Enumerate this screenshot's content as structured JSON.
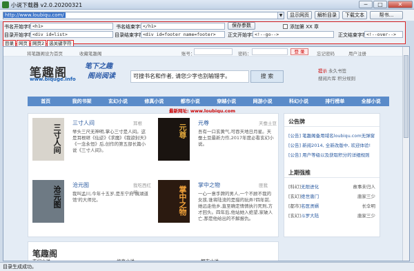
{
  "window": {
    "title": "小说下载器 v2.0.20200321",
    "min_label": "─",
    "max_label": "□",
    "close_label": "✕"
  },
  "toolbar": {
    "url": "http://www.loubiqu.com/",
    "buttons": [
      "显示网页",
      "解析目录",
      "下载文本",
      "帮书..."
    ]
  },
  "config": {
    "row1": [
      {
        "label": "书名开始字符:",
        "value": "<h1>"
      },
      {
        "label": "书名结束字符:",
        "value": "</h1>"
      }
    ],
    "save_label": "保存参数",
    "add_chapter_label": "添加第 XX 章",
    "row2": [
      {
        "label": "目录开始字符:",
        "value": "<div id=list>"
      },
      {
        "label": "目录结束字符:",
        "value": "<div id=footer name=footer>"
      },
      {
        "label": "正文开始字符:",
        "value": "<!--go-->"
      },
      {
        "label": "正文结束字符:",
        "value": "<!--over-->"
      }
    ]
  },
  "tabs": [
    "目录",
    "网页",
    "网页2",
    "选关键字符"
  ],
  "site": {
    "topbar": {
      "left_links": [
        "将笔趣阁设为首页",
        "收藏笔趣阁"
      ],
      "account_label": "账号：",
      "password_label": "密码：",
      "login_label": "登 录",
      "forgot_label": "忘记密码",
      "register_label": "用户注册"
    },
    "logo": "笔趣阁",
    "logo_sub": "www.biquge.info",
    "slogan_line1": "笔下之趣",
    "slogan_line2": "阁尚阅读",
    "search_placeholder": "可搜书名和作者, 请您少字也别输错字。",
    "search_button": "搜 索",
    "right_links": [
      "提示",
      "永久书签",
      "搜阅片库",
      "积分规则"
    ],
    "nav": [
      "首页",
      "我的书架",
      "玄幻小说",
      "修真小说",
      "都市小说",
      "穿越小说",
      "网游小说",
      "科幻小说",
      "排行榜单",
      "全部小说"
    ],
    "notice": "最新网址: www.loubiqu.com",
    "books": [
      {
        "title": "三寸人间",
        "author": "耳根",
        "desc": "举头三尺无神明,掌心三寸是人间。这是耳根继《仙逆》《求魔》《我欲封天》《一念永恒》后,创作的第五部长篇小说《三寸人间》。",
        "cover": "三寸人间",
        "cover_bg": "#d8d4cc",
        "cover_fg": "#1b1b1b"
      },
      {
        "title": "元尊",
        "author": "天蚕土豆",
        "desc": "吾有一口玄黄气,可吞天地日月星。天蚕土豆最新力作,2017年度必看玄幻小说。",
        "cover": "元尊",
        "cover_bg": "#1a1410",
        "cover_fg": "#d9a23a"
      },
      {
        "title": "沧元图",
        "author": "我吃西红柿",
        "desc": "我叫孟川,今年十五岁,是东宁府'镜湖道馆'的大师兄。",
        "cover": "沧元图",
        "cover_bg": "#6e7a84",
        "cover_fg": "#111111"
      },
      {
        "title": "掌中之物",
        "author": "匪我",
        "desc": "一心一意手牌的男人,一个不顾不我的女孩,谁将陆流的是猎的玩弄?四年前,她远走他乡,直至确定情情执行死刑,方才回头。四年后,他站她入绝望,家破人亡,那是他给出的不解报仇。",
        "cover": "掌中之物",
        "cover_bg": "#2b1a10",
        "cover_fg": "#f2a23a"
      }
    ],
    "side": {
      "announce_title": "公告牌",
      "announce": [
        "[公告] 笔趣阁备用域名loubiqu.com无弹窗",
        "[公告] 新阅2014, 全新改版中, 欢迎体验!",
        "[公告] 用户等级以及获取积分的详细规则"
      ],
      "hot_title": "上期强推",
      "hot": [
        {
          "tag": "[科幻]",
          "title": "无限进化",
          "author": "故事未归人"
        },
        {
          "tag": "[玄幻]",
          "title": "绝世唐门",
          "author": "唐家三少"
        },
        {
          "tag": "[都市]",
          "title": "名医贤婿",
          "author": "长伞明"
        },
        {
          "tag": "[玄幻]",
          "title": "斗罗大陆",
          "author": "唐家三少"
        }
      ]
    },
    "bottom_title": "笔趣阁",
    "bottom_cats": [
      "玄幻小说",
      "修真小说",
      "都市小说"
    ]
  },
  "status": "目录生成成功。",
  "colors": {
    "nav": "#5a8bc9",
    "accent": "#c00000",
    "link": "#2a5aa0"
  }
}
